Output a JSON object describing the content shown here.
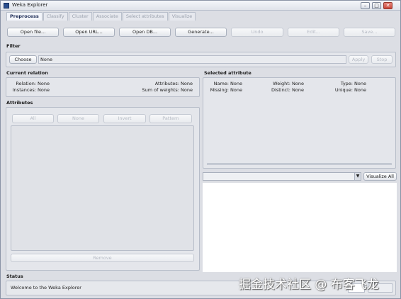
{
  "window": {
    "title": "Weka Explorer",
    "minimize": "–",
    "maximize": "□",
    "close": "✕"
  },
  "tabs": [
    "Preprocess",
    "Classify",
    "Cluster",
    "Associate",
    "Select attributes",
    "Visualize"
  ],
  "toolbar": {
    "open_file": "Open file...",
    "open_url": "Open URL...",
    "open_db": "Open DB...",
    "generate": "Generate...",
    "undo": "Undo",
    "edit": "Edit...",
    "save": "Save..."
  },
  "filter": {
    "label": "Filter",
    "choose": "Choose",
    "value": "None",
    "apply": "Apply",
    "stop": "Stop"
  },
  "current_relation": {
    "label": "Current relation",
    "relation_key": "Relation:",
    "relation_val": "None",
    "instances_key": "Instances:",
    "instances_val": "None",
    "attributes_key": "Attributes:",
    "attributes_val": "None",
    "sum_weights_key": "Sum of weights:",
    "sum_weights_val": "None"
  },
  "attributes": {
    "label": "Attributes",
    "all": "All",
    "none": "None",
    "invert": "Invert",
    "pattern": "Pattern",
    "remove": "Remove"
  },
  "selected_attribute": {
    "label": "Selected attribute",
    "name_key": "Name:",
    "name_val": "None",
    "weight_key": "Weight:",
    "weight_val": "None",
    "type_key": "Type:",
    "type_val": "None",
    "missing_key": "Missing:",
    "missing_val": "None",
    "distinct_key": "Distinct:",
    "distinct_val": "None",
    "unique_key": "Unique:",
    "unique_val": "None"
  },
  "visualize_all": "Visualize All",
  "status": {
    "label": "Status",
    "message": "Welcome to the Weka Explorer"
  },
  "watermark": "掘金技术社区 @ 布客飞龙"
}
